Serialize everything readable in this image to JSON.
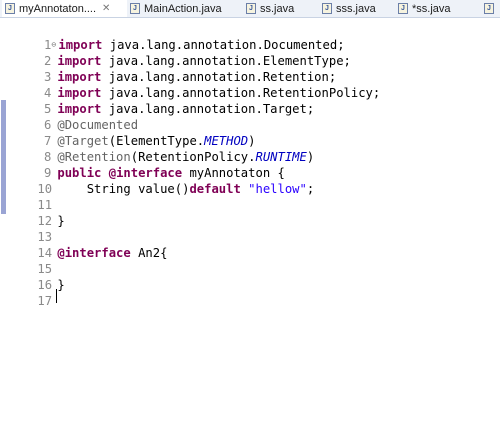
{
  "tabs": [
    {
      "label": "myAnnotaton....",
      "active": true,
      "close": "✕"
    },
    {
      "label": "MainAction.java"
    },
    {
      "label": "ss.java"
    },
    {
      "label": "sss.java"
    },
    {
      "label": "*ss.java"
    },
    {
      "label": ""
    }
  ],
  "code_lines": [
    {
      "n": "1",
      "fold": "⊖",
      "text": "import java.lang.annotation.Documented;"
    },
    {
      "n": "2",
      "text": "import java.lang.annotation.ElementType;"
    },
    {
      "n": "3",
      "text": "import java.lang.annotation.Retention;"
    },
    {
      "n": "4",
      "text": "import java.lang.annotation.RetentionPolicy;"
    },
    {
      "n": "5",
      "text": "import java.lang.annotation.Target;"
    },
    {
      "n": "6",
      "text": "@Documented"
    },
    {
      "n": "7",
      "text": "@Target(ElementType.METHOD)"
    },
    {
      "n": "8",
      "text": "@Retention(RetentionPolicy.RUNTIME)"
    },
    {
      "n": "9",
      "text": "public @interface myAnnotaton {"
    },
    {
      "n": "10",
      "text": "    String value()default \"hellow\";"
    },
    {
      "n": "11",
      "text": ""
    },
    {
      "n": "12",
      "text": "}"
    },
    {
      "n": "13",
      "text": ""
    },
    {
      "n": "14",
      "text": "@interface An2{"
    },
    {
      "n": "15",
      "text": ""
    },
    {
      "n": "16",
      "text": "}"
    },
    {
      "n": "17",
      "text": ""
    }
  ],
  "colors": {
    "keyword": "#7f0055",
    "annotation": "#646464",
    "string": "#2a00ff",
    "constant": "#0000c0"
  },
  "icons": {
    "tab_file": "java-file-icon"
  }
}
